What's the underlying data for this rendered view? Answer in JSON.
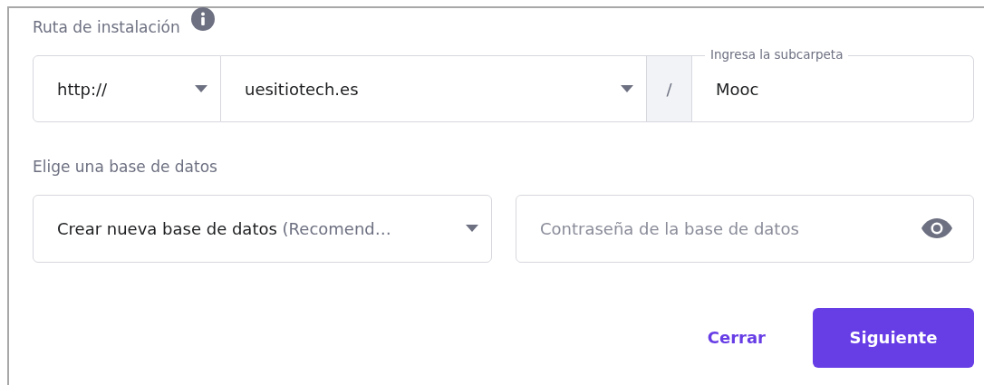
{
  "install_path": {
    "label": "Ruta de instalación",
    "protocol": {
      "value": "http://"
    },
    "domain": {
      "value": "uesitiotech.es"
    },
    "separator": "/",
    "subfolder": {
      "label": "Ingresa la subcarpeta",
      "value": "Mooc"
    }
  },
  "database": {
    "label": "Elige una base de datos",
    "select": {
      "value": "Crear nueva base de datos",
      "note": "(Recomend…"
    },
    "password": {
      "placeholder": "Contraseña de la base de datos"
    }
  },
  "buttons": [
    {
      "label": "Cerrar",
      "kind": "text"
    },
    {
      "label": "Siguiente",
      "kind": "primary"
    }
  ]
}
